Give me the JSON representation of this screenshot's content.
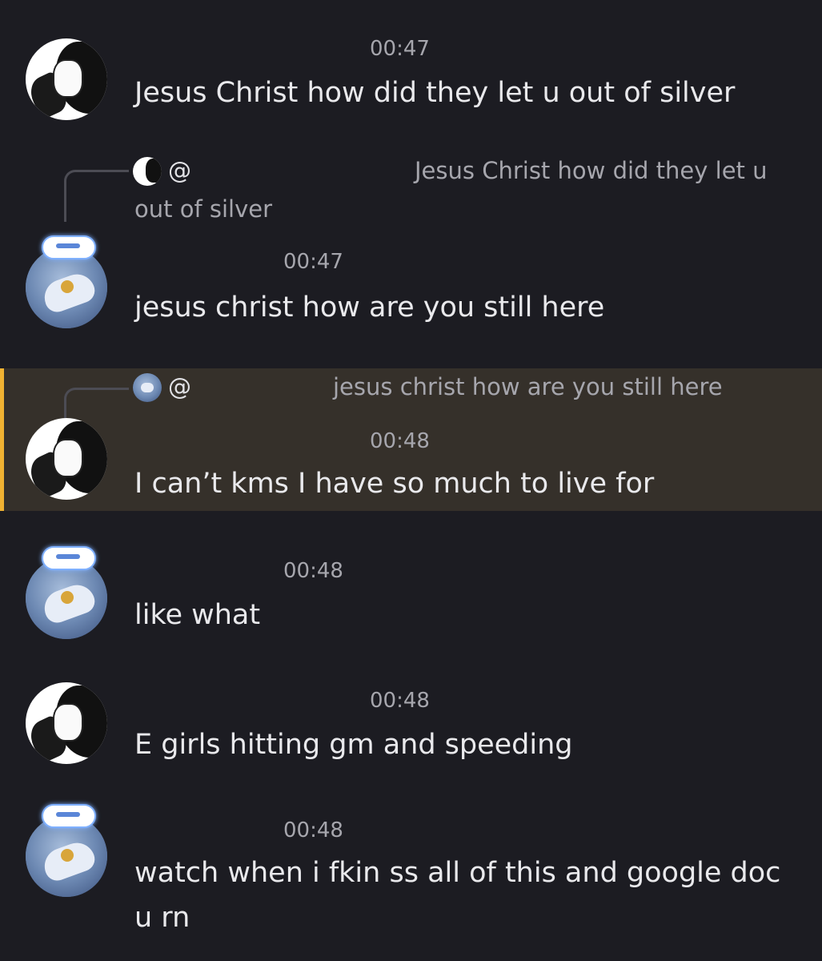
{
  "messages": [
    {
      "time": "00:47",
      "text": "Jesus Christ how did they let u out of silver",
      "avatar": "manga-avatar"
    },
    {
      "reply": {
        "at": "@",
        "text_line1": "Jesus Christ how did they let u",
        "text_line2": "out of silver"
      },
      "time": "00:47",
      "text": "jesus christ how are you still here",
      "avatar": "cinnamoroll-avatar"
    },
    {
      "reply": {
        "at": "@",
        "text": "jesus christ how are you still here"
      },
      "time": "00:48",
      "text": "I can’t kms I have so much to live for",
      "avatar": "manga-avatar",
      "highlighted": true
    },
    {
      "time": "00:48",
      "text": "like what",
      "avatar": "cinnamoroll-avatar"
    },
    {
      "time": "00:48",
      "text": "E girls hitting gm and speeding",
      "avatar": "manga-avatar"
    },
    {
      "time": "00:48",
      "text_line1": "watch when i fkin ss all of this and google doc",
      "text_line2": "u rn",
      "avatar": "cinnamoroll-avatar"
    }
  ],
  "colors": {
    "background": "#1c1c22",
    "highlight_bg": "#35302a",
    "highlight_bar": "#f0b232",
    "timestamp": "#a6a6ad",
    "message_text": "#e9e9ec"
  }
}
